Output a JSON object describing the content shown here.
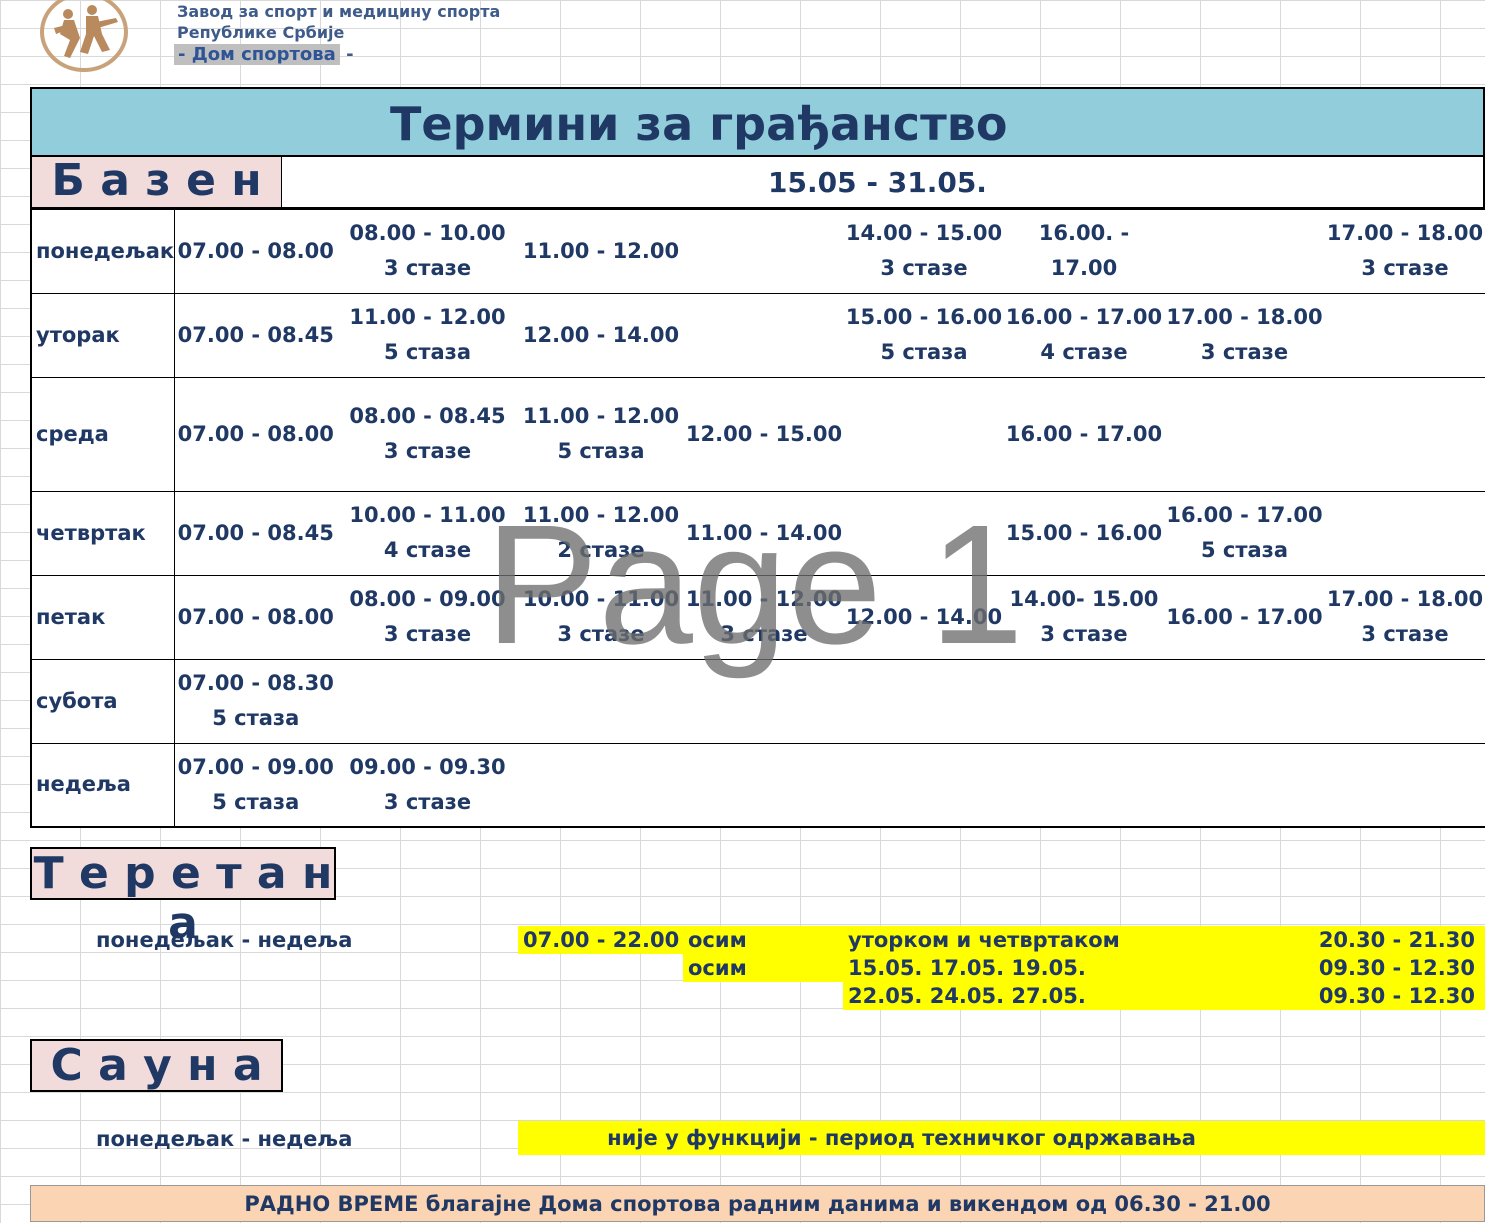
{
  "header": {
    "org_line1": "Завод за спорт и медицину спорта",
    "org_line2": "Републике Србије",
    "org_line3_label": "- Дом спортова",
    "org_line3_dash": " -"
  },
  "title": "Термини  за грађанство",
  "pool": {
    "label": "Б а з е н",
    "date_range": "15.05 - 31.05.",
    "rows": [
      {
        "day": "понедељак",
        "slots": [
          [
            "07.00 - 08.00"
          ],
          [
            "08.00 - 10.00",
            "3 стазе"
          ],
          [
            "11.00 - 12.00"
          ],
          [],
          [
            "14.00 - 15.00",
            "3 стазе"
          ],
          [
            "16.00. -",
            "17.00"
          ],
          [],
          [
            "17.00 - 18.00",
            "3 стазе"
          ]
        ]
      },
      {
        "day": "уторак",
        "slots": [
          [
            "07.00 - 08.45"
          ],
          [
            "11.00 - 12.00",
            "5 стаза"
          ],
          [
            "12.00 - 14.00"
          ],
          [],
          [
            "15.00 - 16.00",
            "5 стаза"
          ],
          [
            "16.00 - 17.00",
            "4 стазе"
          ],
          [
            "17.00 - 18.00",
            "3 стазе"
          ],
          []
        ]
      },
      {
        "day": "среда",
        "slots": [
          [
            "07.00 - 08.00"
          ],
          [
            "08.00 - 08.45",
            "3 стазе"
          ],
          [
            "11.00 - 12.00",
            "5 стаза"
          ],
          [
            "12.00 - 15.00"
          ],
          [],
          [
            "16.00 - 17.00"
          ],
          [],
          []
        ]
      },
      {
        "day": "четвртак",
        "slots": [
          [
            "07.00 - 08.45"
          ],
          [
            "10.00 - 11.00",
            "4 стазе"
          ],
          [
            "11.00 - 12.00",
            "2 стазе"
          ],
          [
            "11.00 - 14.00"
          ],
          [],
          [
            "15.00 - 16.00"
          ],
          [
            "16.00 - 17.00",
            "5 стаза"
          ],
          []
        ]
      },
      {
        "day": "петак",
        "slots": [
          [
            "07.00 - 08.00"
          ],
          [
            "08.00 - 09.00",
            "3 стазе"
          ],
          [
            "10.00 - 11.00",
            "3 стазе"
          ],
          [
            "11.00 - 12.00",
            "3 стазе"
          ],
          [
            "12.00 - 14.00"
          ],
          [
            "14.00- 15.00",
            "3 стазе"
          ],
          [
            "16.00 - 17.00"
          ],
          [
            "17.00 - 18.00",
            "3 стазе"
          ]
        ]
      },
      {
        "day": "субота",
        "slots": [
          [
            "07.00 - 08.30",
            "5 стаза"
          ],
          [],
          [],
          [],
          [],
          [],
          [],
          []
        ]
      },
      {
        "day": "недеља",
        "slots": [
          [
            "07.00 - 09.00",
            "5 стаза"
          ],
          [
            "09.00 - 09.30",
            "3  стазе"
          ],
          [],
          [],
          [],
          [],
          [],
          []
        ]
      }
    ]
  },
  "watermark": "Page 1",
  "gym": {
    "label": "Т е р е т а н а",
    "days": "понедељак - недеља",
    "hours": "07.00 - 22.00",
    "exceptions": [
      {
        "prefix": "осим",
        "when": "уторком и четвртаком",
        "time": "20.30 - 21.30"
      },
      {
        "prefix": "осим",
        "when": "15.05.  17.05.  19.05.",
        "time": "09.30 - 12.30"
      },
      {
        "prefix": "",
        "when": "22.05.  24.05.  27.05.",
        "time": "09.30 - 12.30"
      }
    ]
  },
  "sauna": {
    "label": "С а у н а",
    "days": "понедељак - недеља",
    "status": "није у функцији - период техничког одржавања"
  },
  "footer": "РАДНО ВРЕМЕ благајне Дома спортова радним данима и викендом од 06.30 - 21.00",
  "colors": {
    "text": "#1f3864",
    "title_bg": "#92cddc",
    "label_bg": "#f2dcdb",
    "highlight": "#ffff00",
    "footer_bg": "#fbd4b4"
  }
}
